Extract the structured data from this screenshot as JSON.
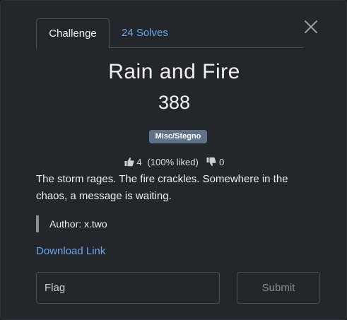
{
  "tabs": [
    {
      "label": "Challenge",
      "active": true
    },
    {
      "label": "24 Solves",
      "active": false
    }
  ],
  "challenge": {
    "name": "Rain and Fire",
    "points": "388",
    "category": "Misc/Stegno",
    "likes": "4",
    "liked_pct": "(100% liked)",
    "dislikes": "0",
    "description": "The storm rages. The fire crackles. Somewhere in the chaos, a message is waiting.",
    "author": "Author: x.two",
    "download_label": "Download Link"
  },
  "form": {
    "flag_placeholder": "Flag",
    "submit_label": "Submit"
  },
  "icons": {
    "close": "close-icon",
    "like": "thumbs-up-icon",
    "dislike": "thumbs-down-icon"
  },
  "colors": {
    "background": "#23272b",
    "link": "#6aa7ea",
    "badge": "#5f7287"
  }
}
